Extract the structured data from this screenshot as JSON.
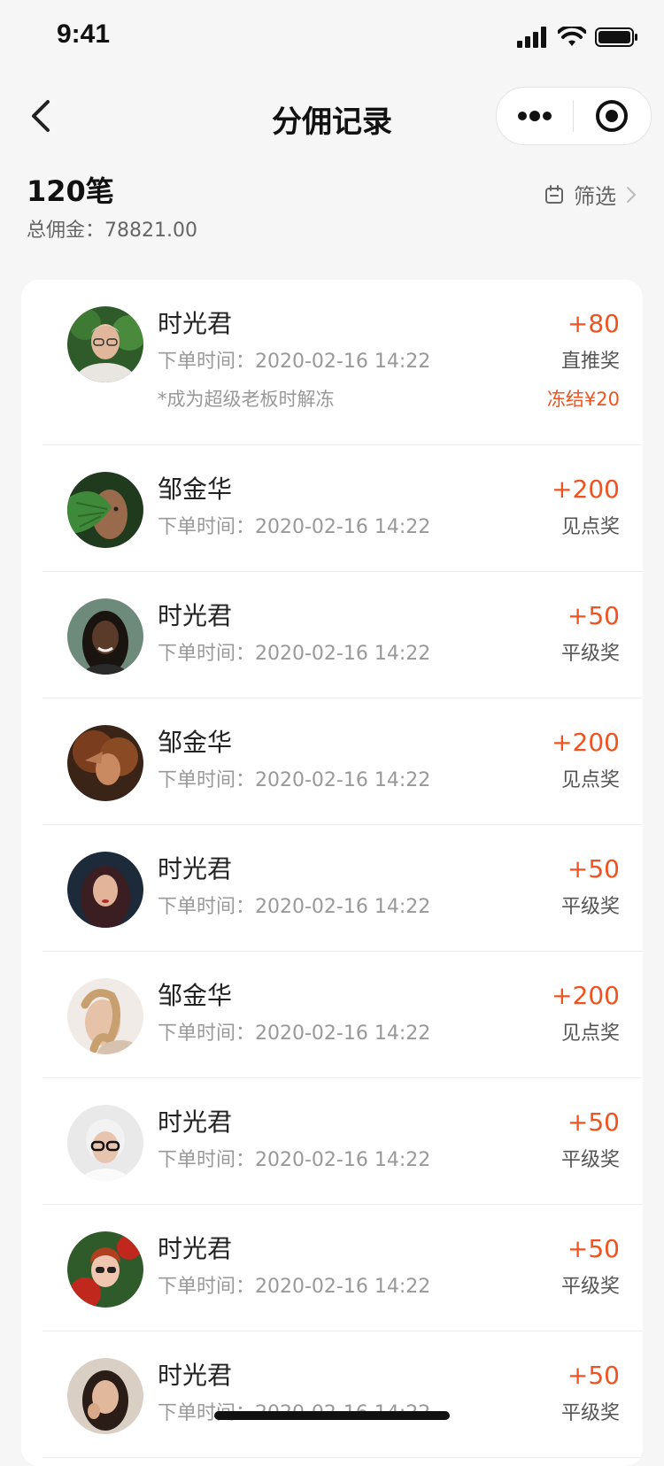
{
  "status_bar": {
    "time": "9:41"
  },
  "nav": {
    "title": "分佣记录"
  },
  "summary": {
    "count": "120笔",
    "total": "总佣金：78821.00",
    "filter_label": "筛选"
  },
  "records": [
    {
      "name": "时光君",
      "time": "下单时间：2020-02-16 14:22",
      "amount": "+80",
      "award": "直推奖",
      "note": "*成为超级老板时解冻",
      "frozen": "冻结¥20"
    },
    {
      "name": "邹金华",
      "time": "下单时间：2020-02-16 14:22",
      "amount": "+200",
      "award": "见点奖"
    },
    {
      "name": "时光君",
      "time": "下单时间：2020-02-16 14:22",
      "amount": "+50",
      "award": "平级奖"
    },
    {
      "name": "邹金华",
      "time": "下单时间：2020-02-16 14:22",
      "amount": "+200",
      "award": "见点奖"
    },
    {
      "name": "时光君",
      "time": "下单时间：2020-02-16 14:22",
      "amount": "+50",
      "award": "平级奖"
    },
    {
      "name": "邹金华",
      "time": "下单时间：2020-02-16 14:22",
      "amount": "+200",
      "award": "见点奖"
    },
    {
      "name": "时光君",
      "time": "下单时间：2020-02-16 14:22",
      "amount": "+50",
      "award": "平级奖"
    },
    {
      "name": "时光君",
      "time": "下单时间：2020-02-16 14:22",
      "amount": "+50",
      "award": "平级奖"
    },
    {
      "name": "时光君",
      "time": "下单时间：2020-02-16 14:22",
      "amount": "+50",
      "award": "平级奖"
    }
  ],
  "colors": {
    "accent": "#f0531f",
    "background": "#f6f6f6"
  }
}
